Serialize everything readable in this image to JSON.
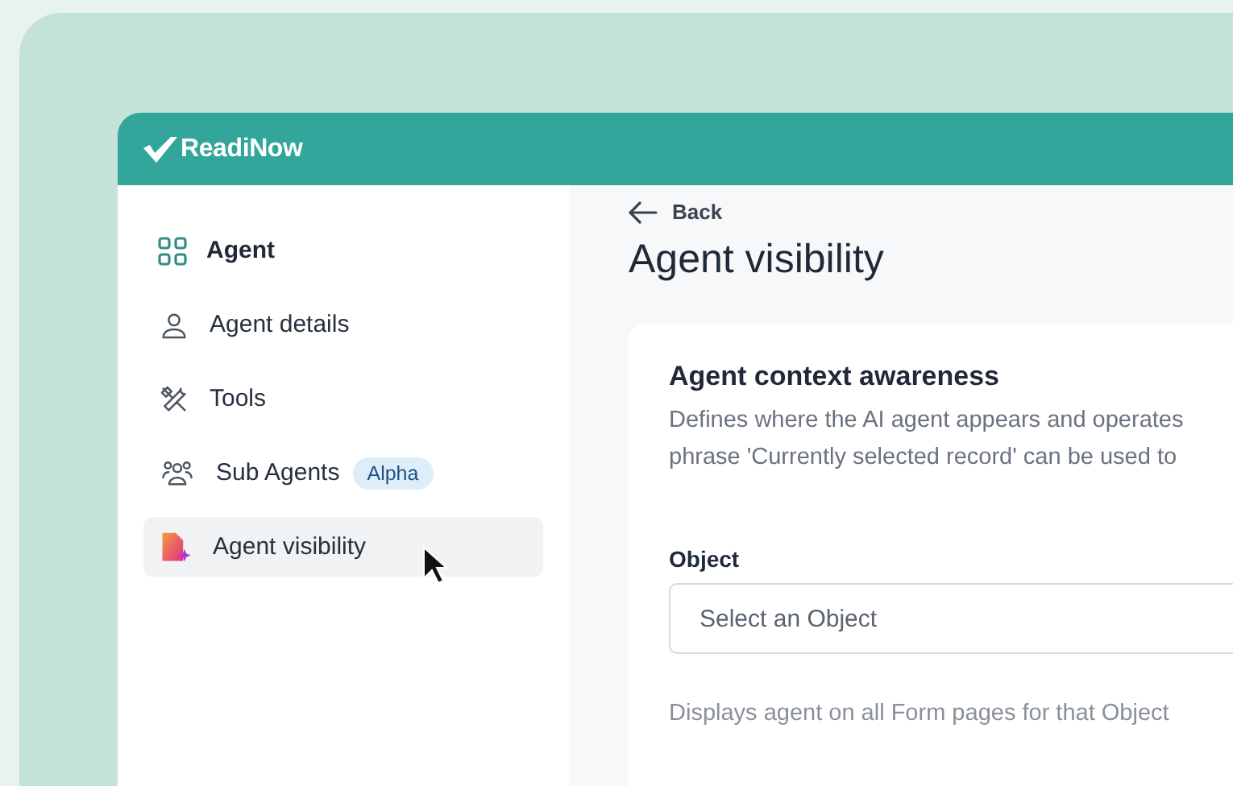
{
  "header": {
    "logo": "ReadiNow"
  },
  "sidebar": {
    "heading": "Agent",
    "items": [
      {
        "label": "Agent details",
        "kind": "person",
        "selected": false
      },
      {
        "label": "Tools",
        "kind": "tools",
        "selected": false
      },
      {
        "label": "Sub Agents",
        "kind": "group",
        "badge": "Alpha",
        "selected": false
      },
      {
        "label": "Agent visibility",
        "kind": "visibility",
        "selected": true
      }
    ]
  },
  "content": {
    "back": "Back",
    "title": "Agent visibility",
    "card": {
      "heading": "Agent context awareness",
      "description": [
        "Defines where the AI agent appears and operates",
        "phrase 'Currently selected record' can be used to"
      ],
      "field": {
        "label": "Object",
        "placeholder": "Select an Object"
      },
      "helper": "Displays agent on all Form pages for that Object"
    }
  }
}
